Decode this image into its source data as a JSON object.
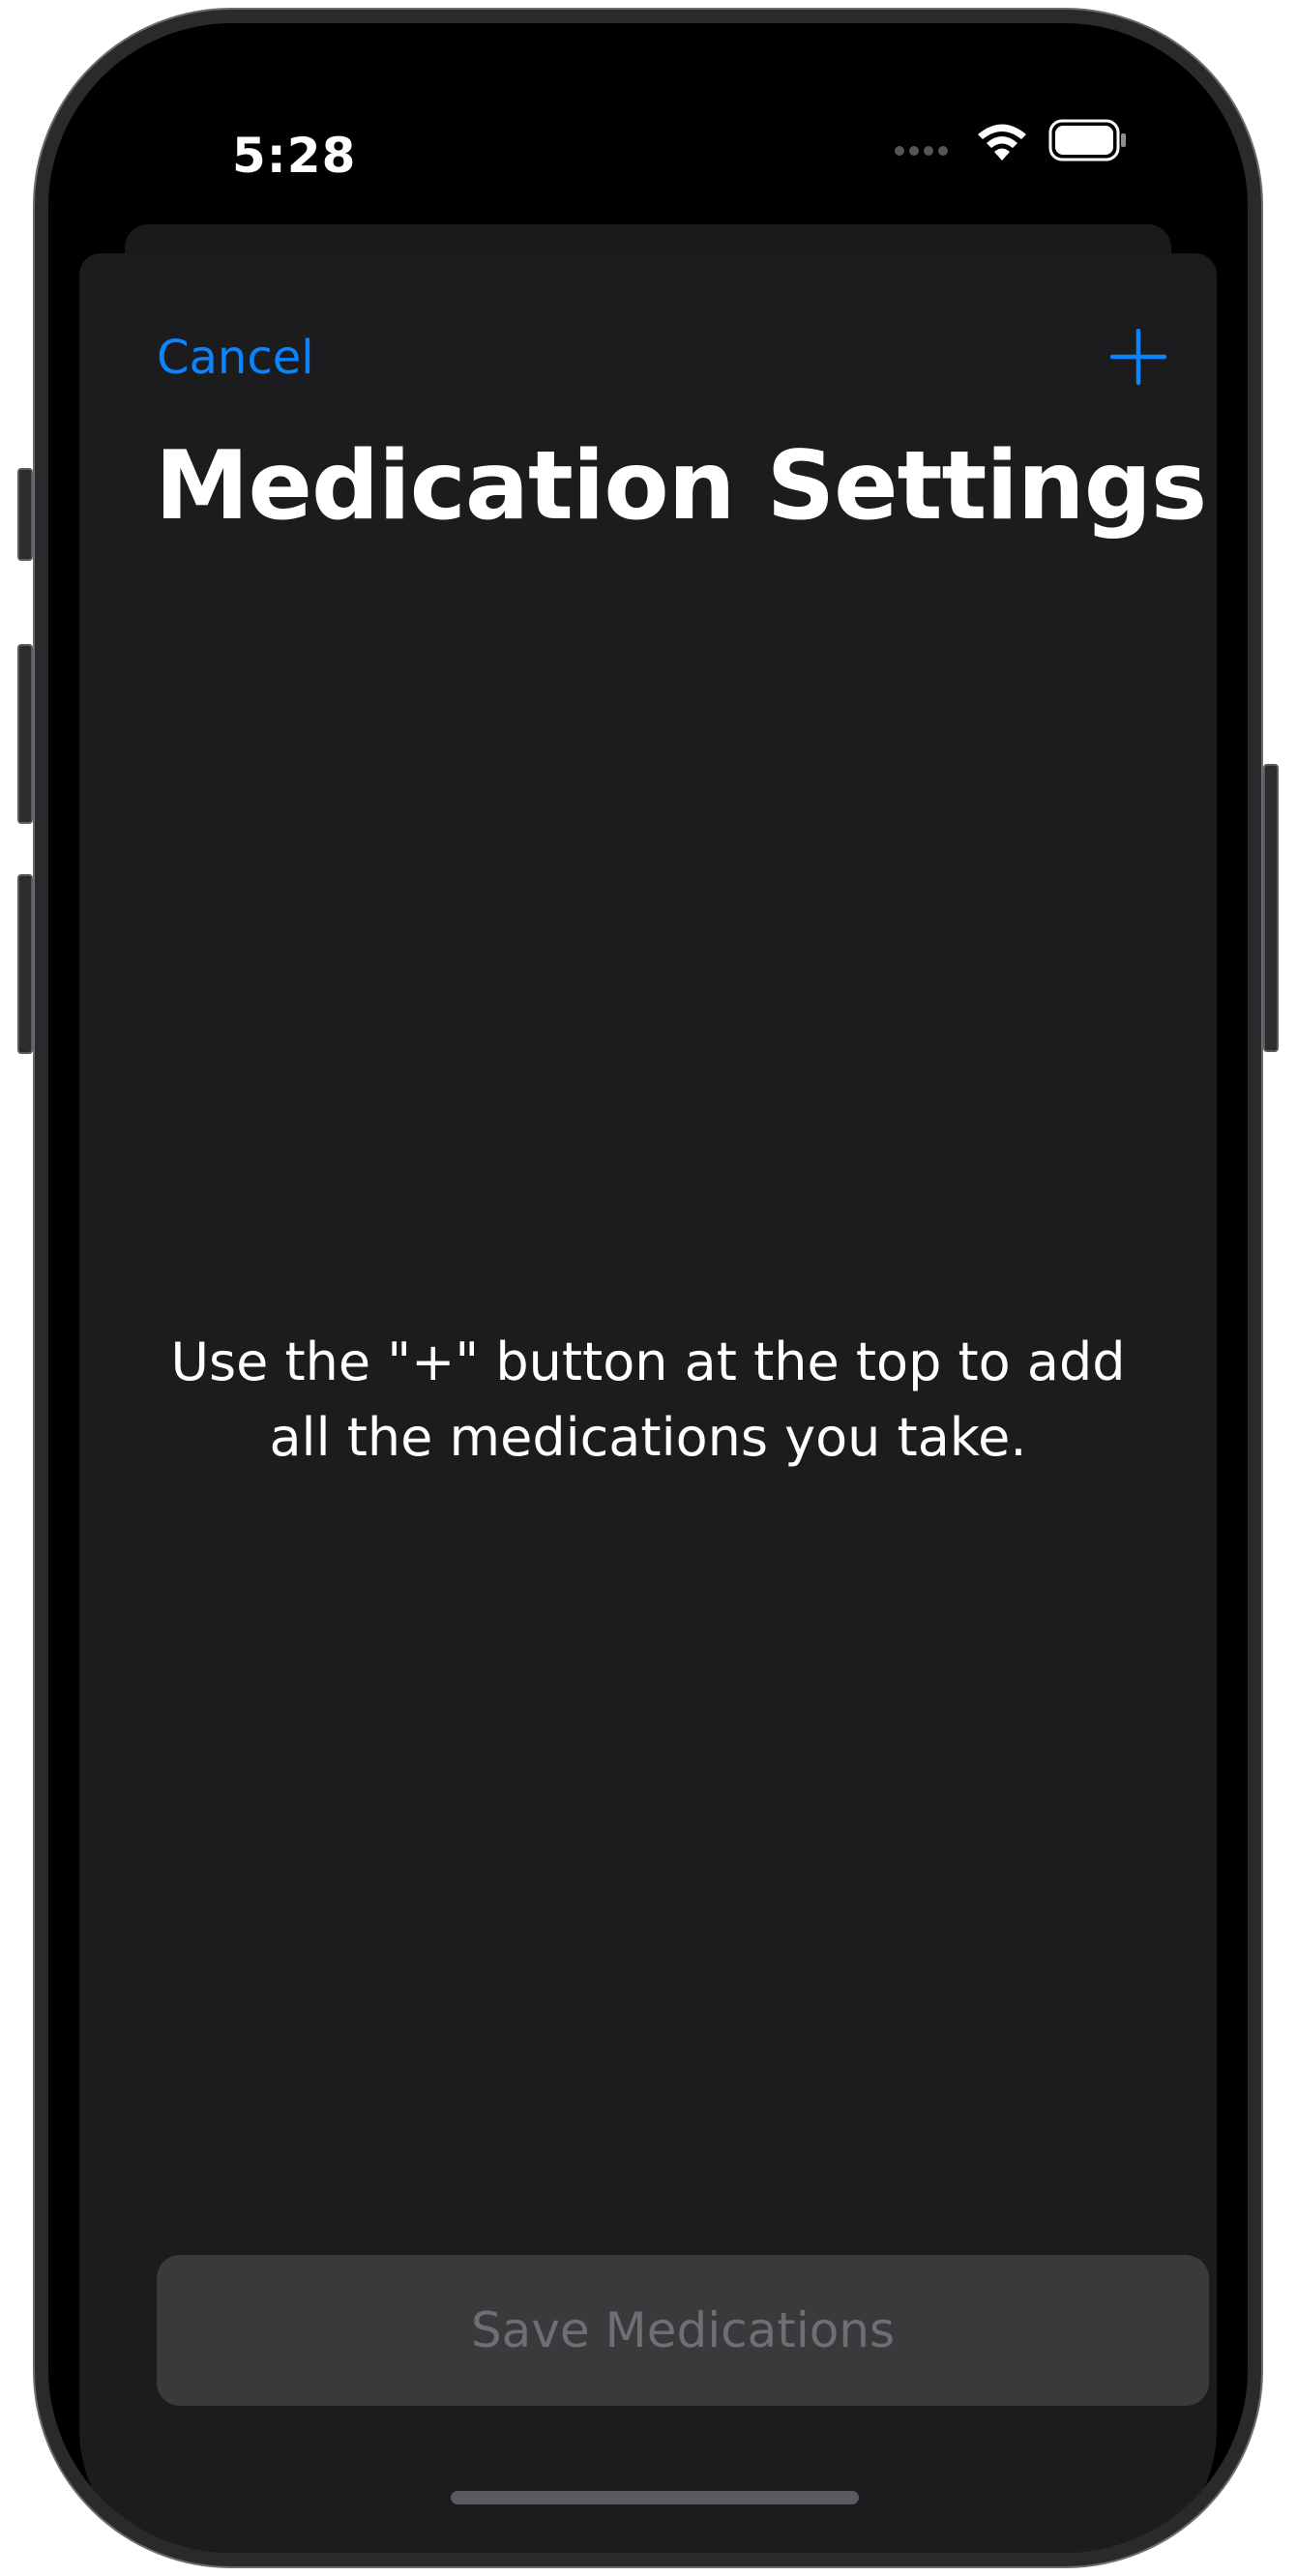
{
  "status_bar": {
    "time": "5:28"
  },
  "nav": {
    "cancel_label": "Cancel",
    "add_icon": "plus-icon"
  },
  "page": {
    "title": "Medication Settings",
    "empty_message": "Use the \"+\" button at the top to add all the medications you take."
  },
  "footer": {
    "save_label": "Save Medications"
  },
  "colors": {
    "accent": "#0a84ff",
    "sheet_background": "#1c1c1e",
    "button_disabled_bg": "#3a3a3c",
    "button_disabled_text": "#6e6e73"
  }
}
